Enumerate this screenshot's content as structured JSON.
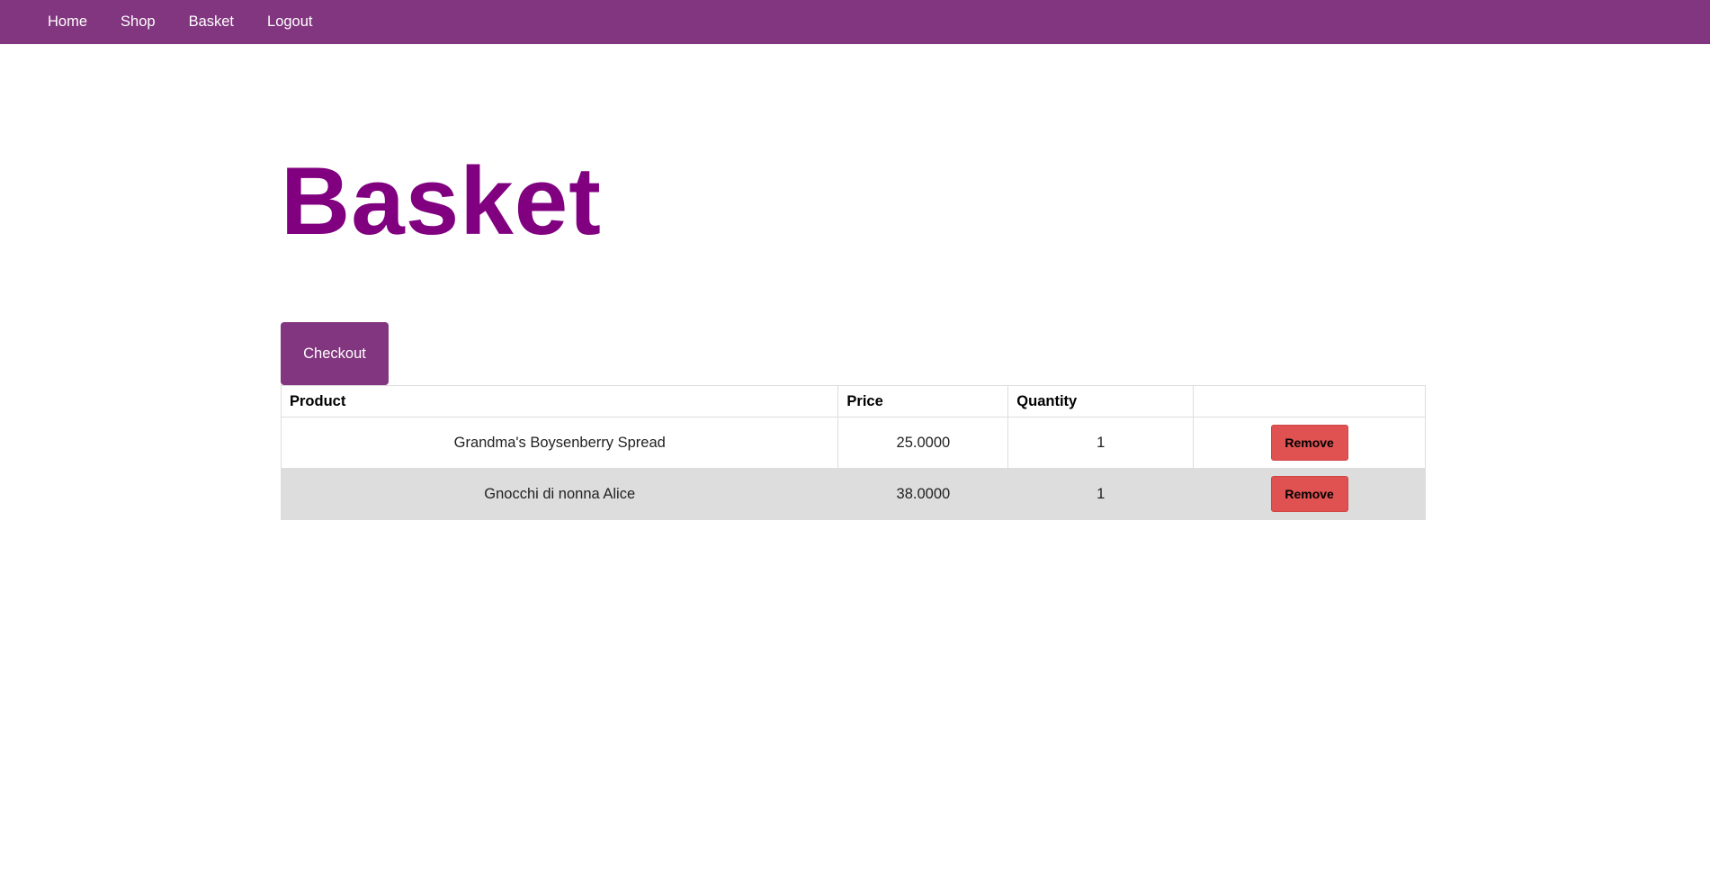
{
  "nav": {
    "items": [
      {
        "label": "Home"
      },
      {
        "label": "Shop"
      },
      {
        "label": "Basket"
      },
      {
        "label": "Logout"
      }
    ],
    "background": "#82367f"
  },
  "page": {
    "title": "Basket",
    "title_color": "#800080"
  },
  "checkout": {
    "label": "Checkout"
  },
  "table": {
    "headers": {
      "product": "Product",
      "price": "Price",
      "quantity": "Quantity",
      "action": ""
    },
    "rows": [
      {
        "product": "Grandma's Boysenberry Spread",
        "price": "25.0000",
        "quantity": "1",
        "action": "Remove"
      },
      {
        "product": "Gnocchi di nonna Alice",
        "price": "38.0000",
        "quantity": "1",
        "action": "Remove"
      }
    ]
  },
  "colors": {
    "remove_button": "#e05252",
    "alt_row": "#dddddd"
  }
}
